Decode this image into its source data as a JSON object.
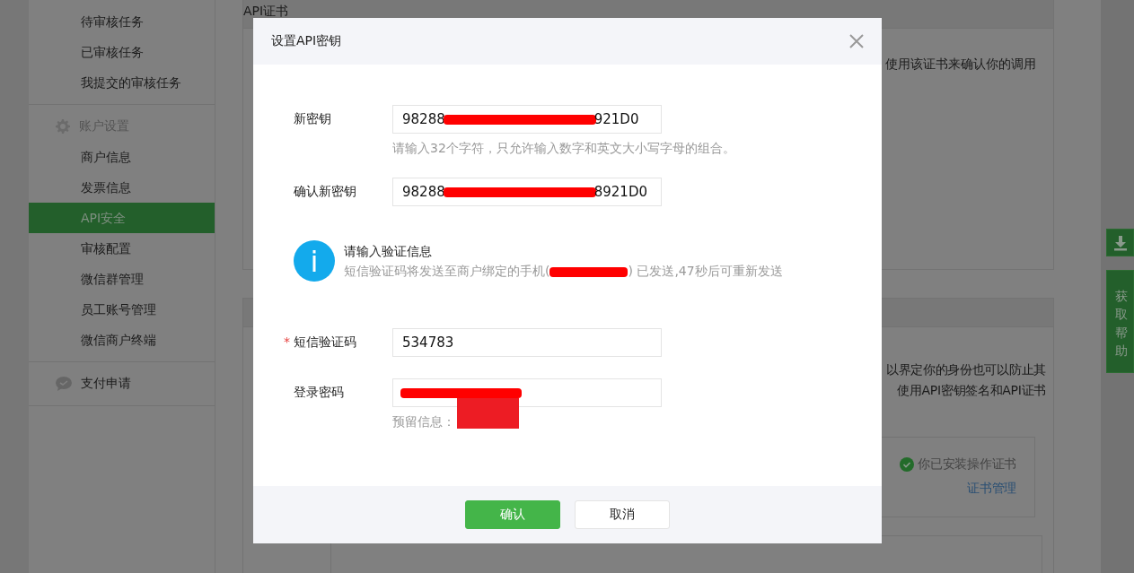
{
  "sidebar": {
    "sections": [
      {
        "items": [
          {
            "label": "待审核任务",
            "selected": false
          },
          {
            "label": "已审核任务",
            "selected": false
          },
          {
            "label": "我提交的审核任务",
            "selected": false
          }
        ]
      },
      {
        "header": {
          "label": "账户设置",
          "kind": "gear"
        },
        "items": [
          {
            "label": "商户信息",
            "selected": false
          },
          {
            "label": "发票信息",
            "selected": false
          },
          {
            "label": "API安全",
            "selected": true
          },
          {
            "label": "审核配置",
            "selected": false
          },
          {
            "label": "微信群管理",
            "selected": false
          },
          {
            "label": "员工账号管理",
            "selected": false
          },
          {
            "label": "微信商户终端",
            "selected": false
          }
        ]
      },
      {
        "header": {
          "label": "支付申请",
          "kind": "chat"
        }
      }
    ]
  },
  "background": {
    "panels": [
      {
        "title": "API证书",
        "lines": [
          "使用该证书来确认你的调用"
        ]
      },
      {
        "lines": [
          "以界定你的身份也可以防止其",
          "使用API密钥签名和API证书"
        ],
        "status": "你已安装操作证书",
        "link": "证书管理"
      }
    ]
  },
  "help": {
    "label": "获取帮助"
  },
  "dialog": {
    "title": "设置API密钥",
    "key_fields": [
      {
        "label": "新密钥",
        "value": [
          {
            "kind": "text",
            "text": "98288"
          },
          {
            "kind": "redacted"
          },
          {
            "kind": "text",
            "text": "921D0"
          }
        ],
        "hint": [
          {
            "kind": "text",
            "text": "请输入32个字符，只允许输入数字和英文大小写字母的组合。"
          }
        ]
      },
      {
        "label": "确认新密钥",
        "value": [
          {
            "kind": "text",
            "text": "98288"
          },
          {
            "kind": "redacted"
          },
          {
            "kind": "text",
            "text": "8921D0"
          }
        ]
      }
    ],
    "notice": {
      "title": "请输入验证信息",
      "text": [
        {
          "kind": "text",
          "text": "短信验证码将发送至商户绑定的手机("
        },
        {
          "kind": "redacted"
        },
        {
          "kind": "text",
          "text": ") 已发送,47秒后可重新发送"
        }
      ]
    },
    "verify_fields": [
      {
        "label": "短信验证码",
        "required_mark": "*",
        "value": [
          {
            "kind": "text",
            "text": "534783"
          }
        ]
      },
      {
        "label": "登录密码",
        "value": [
          {
            "kind": "redacted"
          }
        ],
        "hint": [
          {
            "kind": "text",
            "text": "预留信息："
          },
          {
            "kind": "block"
          }
        ]
      }
    ],
    "buttons": [
      {
        "label": "确认",
        "kind": "primary"
      },
      {
        "label": "取消",
        "kind": "default"
      }
    ]
  }
}
